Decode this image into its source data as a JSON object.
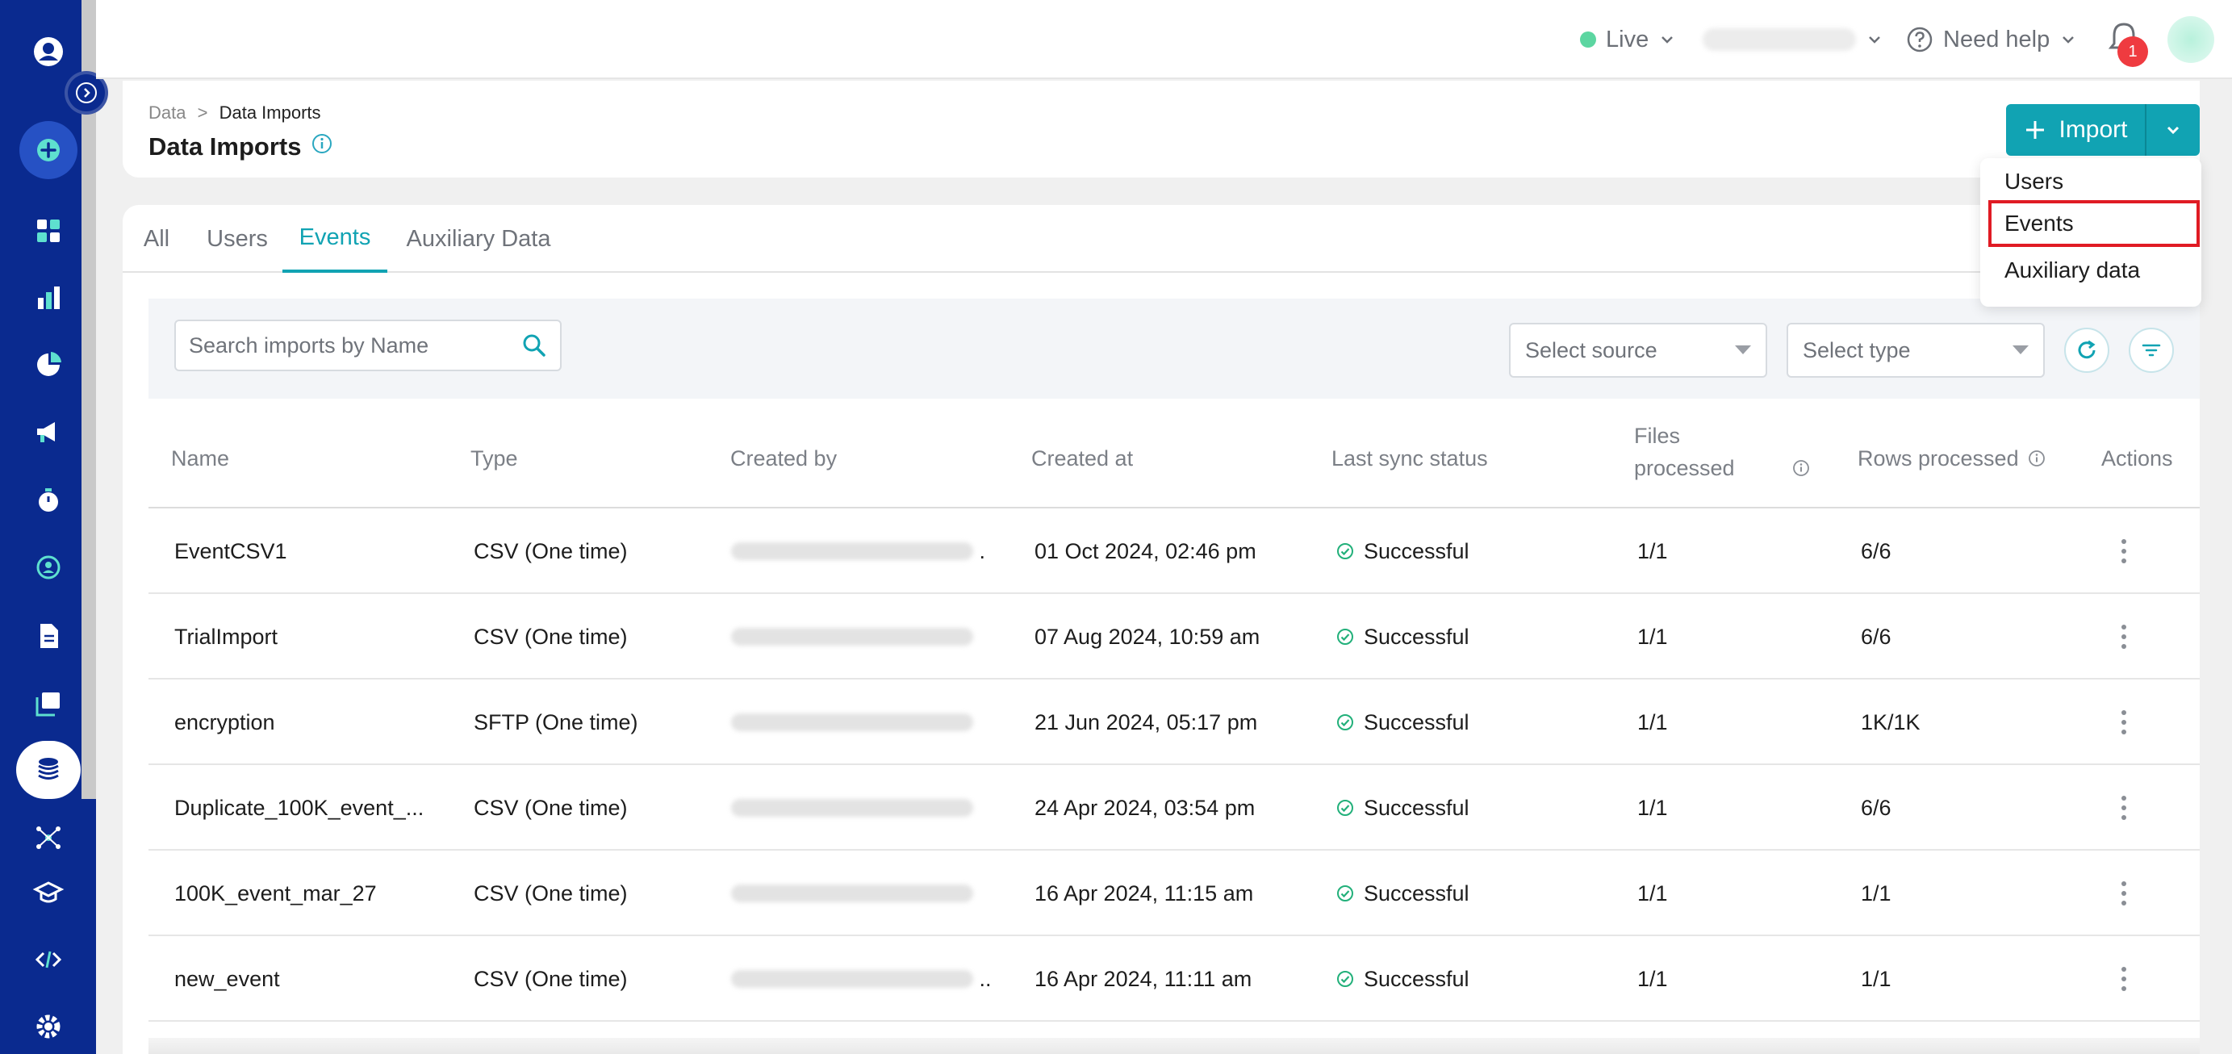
{
  "topbar": {
    "env_label": "Live",
    "help_label": "Need help",
    "notification_count": "1"
  },
  "breadcrumb": {
    "parent": "Data",
    "separator": ">",
    "current": "Data Imports"
  },
  "page": {
    "title": "Data Imports"
  },
  "import": {
    "label": "Import",
    "menu": [
      "Users",
      "Events",
      "Auxiliary data"
    ],
    "highlighted": "Events"
  },
  "tabs": [
    "All",
    "Users",
    "Events",
    "Auxiliary Data"
  ],
  "active_tab": "Events",
  "filters": {
    "search_placeholder": "Search imports by Name",
    "source_placeholder": "Select source",
    "type_placeholder": "Select type"
  },
  "table": {
    "headers": {
      "name": "Name",
      "type": "Type",
      "created_by": "Created by",
      "created_at": "Created at",
      "last_sync": "Last sync status",
      "files_line1": "Files",
      "files_line2": "processed",
      "rows": "Rows processed",
      "actions": "Actions"
    },
    "rows": [
      {
        "name": "EventCSV1",
        "type": "CSV (One time)",
        "created_at": "01 Oct 2024, 02:46 pm",
        "status": "Successful",
        "files": "1/1",
        "rows": "6/6"
      },
      {
        "name": "TrialImport",
        "type": "CSV (One time)",
        "created_at": "07 Aug 2024, 10:59 am",
        "status": "Successful",
        "files": "1/1",
        "rows": "6/6"
      },
      {
        "name": "encryption",
        "type": "SFTP (One time)",
        "created_at": "21 Jun 2024, 05:17 pm",
        "status": "Successful",
        "files": "1/1",
        "rows": "1K/1K"
      },
      {
        "name": "Duplicate_100K_event_...",
        "type": "CSV (One time)",
        "created_at": "24 Apr 2024, 03:54 pm",
        "status": "Successful",
        "files": "1/1",
        "rows": "6/6"
      },
      {
        "name": "100K_event_mar_27",
        "type": "CSV (One time)",
        "created_at": "16 Apr 2024, 11:15 am",
        "status": "Successful",
        "files": "1/1",
        "rows": "1/1"
      },
      {
        "name": "new_event",
        "type": "CSV (One time)",
        "created_at": "16 Apr 2024, 11:11 am",
        "status": "Successful",
        "files": "1/1",
        "rows": "1/1"
      }
    ]
  },
  "colors": {
    "sidebar": "#0a2a8f",
    "accent": "#11a3b3",
    "success": "#22b07a",
    "badge": "#ef3b40",
    "highlight": "#e01b24"
  }
}
